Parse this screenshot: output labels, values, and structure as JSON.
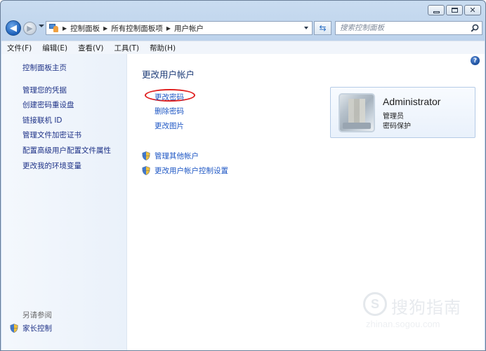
{
  "window": {
    "caption_buttons": {
      "minimize_icon": "minimize-icon",
      "maximize_icon": "maximize-icon",
      "close_glyph": "✕"
    }
  },
  "navigation": {
    "back_glyph": "◀",
    "forward_glyph": "▶",
    "breadcrumb": [
      "控制面板",
      "所有控制面板项",
      "用户帐户"
    ],
    "separator": "▶",
    "refresh_glyph": "⇆",
    "search_placeholder": "搜索控制面板"
  },
  "menu": {
    "items": [
      "文件(F)",
      "编辑(E)",
      "查看(V)",
      "工具(T)",
      "帮助(H)"
    ]
  },
  "sidebar": {
    "home": "控制面板主页",
    "links": [
      "管理您的凭据",
      "创建密码重设盘",
      "链接联机 ID",
      "管理文件加密证书",
      "配置高级用户配置文件属性",
      "更改我的环境变量"
    ],
    "see_also": "另请参阅",
    "parental_controls": "家长控制"
  },
  "main": {
    "help_glyph": "?",
    "title": "更改用户帐户",
    "tasks": [
      "更改密码",
      "删除密码",
      "更改图片"
    ],
    "admin_tasks": [
      "管理其他帐户",
      "更改用户帐户控制设置"
    ]
  },
  "account": {
    "name": "Administrator",
    "type": "管理员",
    "status": "密码保护"
  },
  "watermark": {
    "logo_glyph": "S",
    "text": "搜狗指南",
    "url": "zhinan.sogou.com"
  },
  "colors": {
    "link": "#1d56c4",
    "sidebar_link": "#1e3287",
    "highlight": "#e02020",
    "frame": "#bcd2ec"
  }
}
